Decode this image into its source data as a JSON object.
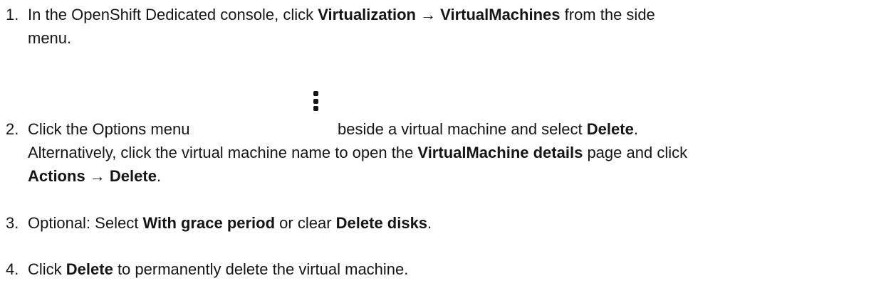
{
  "steps": [
    {
      "number": "1.",
      "lines": [
        {
          "parts": [
            {
              "text": "In the OpenShift Dedicated console, click ",
              "bold": false
            },
            {
              "text": "Virtualization → VirtualMachines",
              "bold": true
            },
            {
              "text": " from the side",
              "bold": false
            }
          ]
        },
        {
          "parts": [
            {
              "text": "menu.",
              "bold": false
            }
          ]
        }
      ]
    },
    {
      "number": "2.",
      "lines": [
        {
          "parts": [
            {
              "text": "Click the Options menu",
              "bold": false
            },
            {
              "text": "beside a virtual machine and select ",
              "bold": false
            },
            {
              "text": "Delete",
              "bold": true
            },
            {
              "text": ".",
              "bold": false
            }
          ]
        },
        {
          "parts": [
            {
              "text": "Alternatively, click the virtual machine name to open the ",
              "bold": false
            },
            {
              "text": "VirtualMachine details",
              "bold": true
            },
            {
              "text": " page and click",
              "bold": false
            }
          ]
        },
        {
          "parts": [
            {
              "text": "Actions → Delete",
              "bold": true
            },
            {
              "text": ".",
              "bold": false
            }
          ]
        }
      ]
    },
    {
      "number": "3.",
      "lines": [
        {
          "parts": [
            {
              "text": "Optional: Select ",
              "bold": false
            },
            {
              "text": "With grace period",
              "bold": true
            },
            {
              "text": " or clear ",
              "bold": false
            },
            {
              "text": "Delete disks",
              "bold": true
            },
            {
              "text": ".",
              "bold": false
            }
          ]
        }
      ]
    },
    {
      "number": "4.",
      "lines": [
        {
          "parts": [
            {
              "text": "Click ",
              "bold": false
            },
            {
              "text": "Delete",
              "bold": true
            },
            {
              "text": " to permanently delete the virtual machine.",
              "bold": false
            }
          ]
        }
      ]
    }
  ],
  "options_icon": "kebab-vertical-icon"
}
